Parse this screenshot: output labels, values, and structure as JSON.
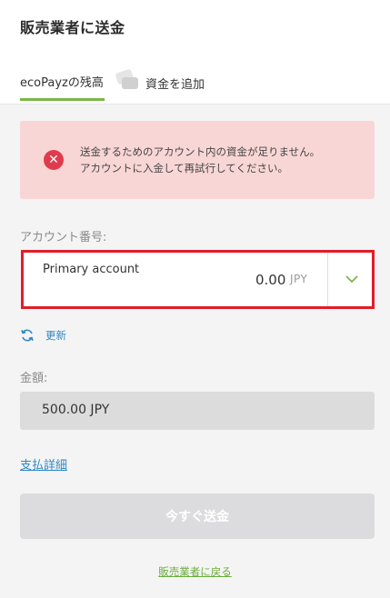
{
  "header": {
    "title": "販売業者に送金"
  },
  "tabs": {
    "balance_label": "ecoPayzの残高",
    "add_funds_label": "資金を追加",
    "add_funds_icon": "credit-cards-icon"
  },
  "alert": {
    "icon": "error-x-icon",
    "color": "#e03b4c",
    "background": "#f9d6d6",
    "line1": "送金するためのアカウント内の資金が足りません。",
    "line2": "アカウントに入金して再試行してください。"
  },
  "account": {
    "label": "アカウント番号:",
    "name": "Primary account",
    "balance": "0.00",
    "currency": "JPY",
    "dropdown_icon": "chevron-down-icon"
  },
  "refresh": {
    "icon": "refresh-icon",
    "label": "更新"
  },
  "amount": {
    "label": "金額:",
    "value": "500.00 JPY"
  },
  "payment_details_link": "支払詳細",
  "send_button": "今すぐ送金",
  "back_link": "販売業者に戻る",
  "colors": {
    "accent_green": "#7ab648",
    "link_blue": "#2f87c6",
    "highlight_red": "#e11c2a"
  }
}
